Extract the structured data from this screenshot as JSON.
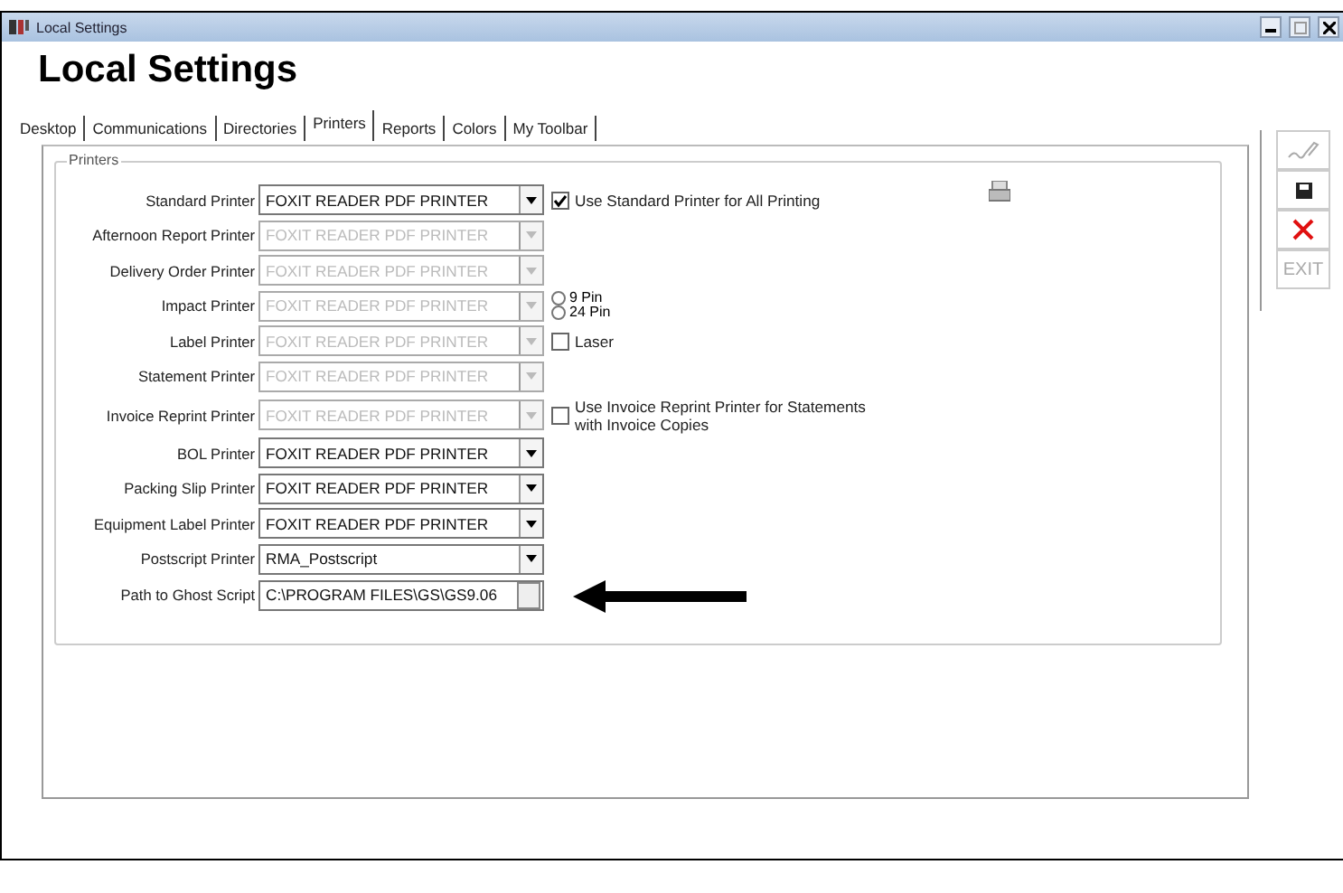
{
  "window": {
    "title": "Local Settings"
  },
  "heading": "Local Settings",
  "tabs": [
    {
      "label": "Desktop",
      "selected": false
    },
    {
      "label": "Communications",
      "selected": false
    },
    {
      "label": "Directories",
      "selected": false
    },
    {
      "label": "Printers",
      "selected": true
    },
    {
      "label": "Reports",
      "selected": false
    },
    {
      "label": "Colors",
      "selected": false
    },
    {
      "label": "My Toolbar",
      "selected": false
    }
  ],
  "group": {
    "title": "Printers"
  },
  "rows": [
    {
      "label": "Standard Printer",
      "value": "FOXIT READER PDF PRINTER",
      "kind": "combo",
      "disabled": false,
      "option": {
        "kind": "checkbox",
        "label": "Use Standard Printer for All Printing",
        "checked": true
      }
    },
    {
      "label": "Afternoon Report Printer",
      "value": "FOXIT READER PDF PRINTER",
      "kind": "combo",
      "disabled": true
    },
    {
      "label": "Delivery Order Printer",
      "value": "FOXIT READER PDF PRINTER",
      "kind": "combo",
      "disabled": true
    },
    {
      "label": "Impact Printer",
      "value": "FOXIT READER PDF PRINTER",
      "kind": "combo",
      "disabled": true,
      "option": {
        "kind": "radios",
        "options": [
          {
            "label": "9 Pin",
            "selected": false
          },
          {
            "label": "24 Pin",
            "selected": false
          }
        ]
      }
    },
    {
      "label": "Label Printer",
      "value": "FOXIT READER PDF PRINTER",
      "kind": "combo",
      "disabled": true,
      "option": {
        "kind": "checkbox",
        "label": "Laser",
        "checked": false
      }
    },
    {
      "label": "Statement Printer",
      "value": "FOXIT READER PDF PRINTER",
      "kind": "combo",
      "disabled": true
    },
    {
      "label": "Invoice Reprint Printer",
      "value": "FOXIT READER PDF PRINTER",
      "kind": "combo",
      "disabled": true,
      "option": {
        "kind": "checkbox",
        "label": "Use Invoice Reprint Printer for Statements with Invoice Copies",
        "checked": false
      }
    },
    {
      "label": "BOL Printer",
      "value": "FOXIT READER PDF PRINTER",
      "kind": "combo",
      "disabled": false
    },
    {
      "label": "Packing Slip Printer",
      "value": "FOXIT READER PDF PRINTER",
      "kind": "combo",
      "disabled": false
    },
    {
      "label": "Equipment Label Printer",
      "value": "FOXIT READER PDF PRINTER",
      "kind": "combo",
      "disabled": false
    },
    {
      "label": "Postscript Printer",
      "value": "RMA_Postscript",
      "kind": "combo",
      "disabled": false
    },
    {
      "label": "Path to Ghost Script",
      "value": "C:\\PROGRAM FILES\\GS\\GS9.06",
      "kind": "path",
      "disabled": false
    }
  ],
  "toolbar": [
    {
      "kind": "sign",
      "disabled": true
    },
    {
      "kind": "save",
      "disabled": false
    },
    {
      "kind": "delete",
      "disabled": false
    },
    {
      "kind": "text",
      "label": "EXIT",
      "disabled": true
    }
  ]
}
